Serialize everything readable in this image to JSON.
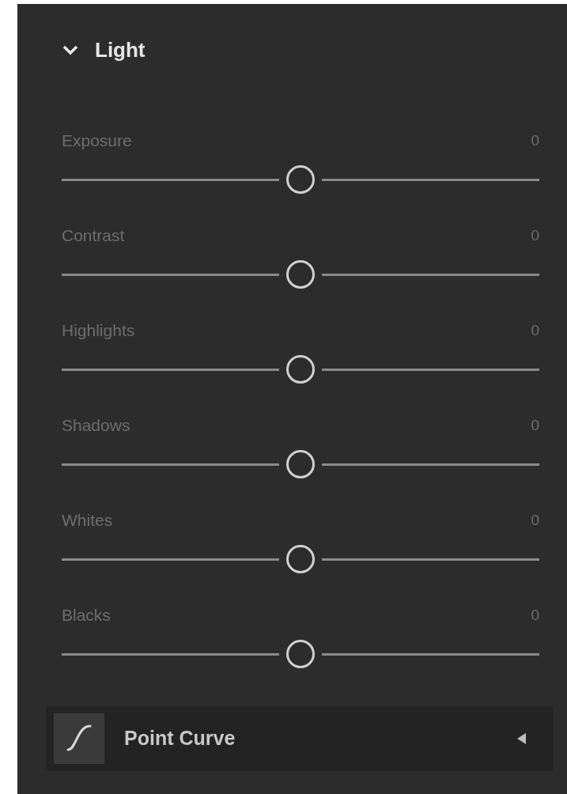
{
  "section": {
    "title": "Light",
    "expanded": true
  },
  "sliders": [
    {
      "label": "Exposure",
      "value": "0",
      "level": 0.5
    },
    {
      "label": "Contrast",
      "value": "0",
      "level": 0.5
    },
    {
      "label": "Highlights",
      "value": "0",
      "level": 0.5
    },
    {
      "label": "Shadows",
      "value": "0",
      "level": 0.5
    },
    {
      "label": "Whites",
      "value": "0",
      "level": 0.5
    },
    {
      "label": "Blacks",
      "value": "0",
      "level": 0.5
    }
  ],
  "next_section": {
    "title": "Point Curve",
    "expanded": false
  }
}
